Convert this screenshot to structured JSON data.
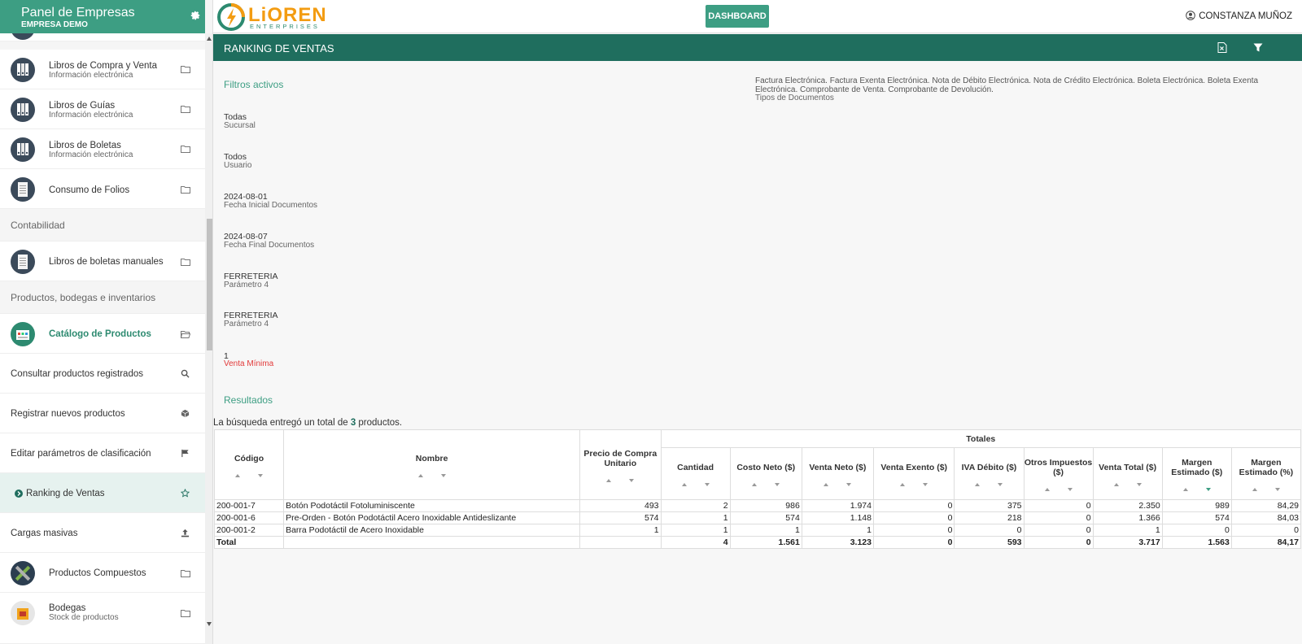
{
  "sidebar": {
    "title": "Panel de Empresas",
    "subtitle": "EMPRESA DEMO",
    "items": [
      {
        "label": "Libros de Compra y Venta",
        "sub": "Información electrónica"
      },
      {
        "label": "Libros de Guías",
        "sub": "Información electrónica"
      },
      {
        "label": "Libros de Boletas",
        "sub": "Información electrónica"
      },
      {
        "label": "Consumo de Folios"
      },
      {
        "section": "Contabilidad"
      },
      {
        "label": "Libros de boletas manuales"
      },
      {
        "section": "Productos, bodegas e inventarios"
      },
      {
        "label": "Catálogo de Productos"
      },
      {
        "label": "Consultar productos registrados"
      },
      {
        "label": "Registrar nuevos productos"
      },
      {
        "label": "Editar parámetros de clasificación"
      },
      {
        "label": "Ranking de Ventas"
      },
      {
        "label": "Cargas masivas"
      },
      {
        "label": "Productos Compuestos"
      },
      {
        "label": "Bodegas",
        "sub": "Stock de productos"
      }
    ]
  },
  "topbar": {
    "logo_main": "LiOREN",
    "logo_sub": "ENTERPRISES",
    "dashboard_label": "DASHBOARD",
    "user_name": "CONSTANZA MUÑOZ"
  },
  "section": {
    "title": "RANKING DE VENTAS"
  },
  "filters": {
    "heading": "Filtros activos",
    "doc_types_value": "Factura Electrónica. Factura Exenta Electrónica. Nota de Débito Electrónica. Nota de Crédito Electrónica. Boleta Electrónica. Boleta Exenta Electrónica. Comprobante de Venta. Comprobante de Devolución.",
    "doc_types_label": "Tipos de Documentos",
    "items": [
      {
        "value": "Todas",
        "label": "Sucursal"
      },
      {
        "value": "Todos",
        "label": "Usuario"
      },
      {
        "value": "2024-08-01",
        "label": "Fecha Inicial Documentos"
      },
      {
        "value": "2024-08-07",
        "label": "Fecha Final Documentos"
      },
      {
        "value": "FERRETERIA",
        "label": "Parámetro 4"
      },
      {
        "value": "FERRETERIA",
        "label": "Parámetro 4"
      },
      {
        "value": "1",
        "label": "Venta Mínima"
      }
    ]
  },
  "results": {
    "heading": "Resultados",
    "text_before": "La búsqueda entregó un total de ",
    "count": "3",
    "text_after": " productos."
  },
  "table": {
    "group_header": "Totales",
    "headers": [
      "Código",
      "Nombre",
      "Precio de Compra Unitario",
      "Cantidad",
      "Costo Neto ($)",
      "Venta Neto ($)",
      "Venta Exento ($)",
      "IVA Débito ($)",
      "Otros Impuestos ($)",
      "Venta Total ($)",
      "Margen Estimado ($)",
      "Margen Estimado (%)"
    ],
    "rows": [
      [
        "200-001-7",
        "Botón Podotáctil Fotoluminiscente",
        "493",
        "2",
        "986",
        "1.974",
        "0",
        "375",
        "0",
        "2.350",
        "989",
        "84,29"
      ],
      [
        "200-001-6",
        "Pre-Orden - Botón Podotáctil Acero Inoxidable Antideslizante",
        "574",
        "1",
        "574",
        "1.148",
        "0",
        "218",
        "0",
        "1.366",
        "574",
        "84,03"
      ],
      [
        "200-001-2",
        "Barra Podotáctil de Acero Inoxidable",
        "1",
        "1",
        "1",
        "1",
        "0",
        "0",
        "0",
        "1",
        "0",
        "0"
      ]
    ],
    "total_row": [
      "Total",
      "",
      "",
      "4",
      "1.561",
      "3.123",
      "0",
      "593",
      "0",
      "3.717",
      "1.563",
      "84,17"
    ]
  }
}
